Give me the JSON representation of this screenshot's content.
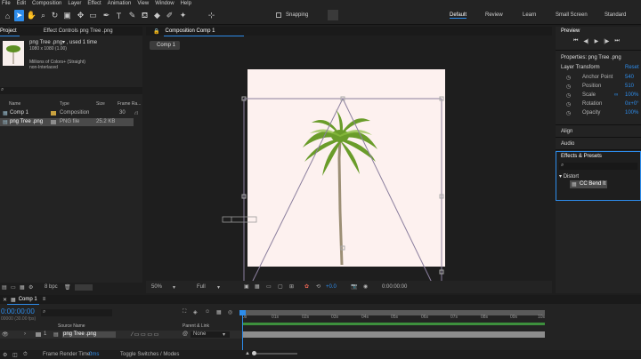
{
  "menu": [
    "File",
    "Edit",
    "Composition",
    "Layer",
    "Effect",
    "Animation",
    "View",
    "Window",
    "Help"
  ],
  "toolbar": {
    "snapping_label": "Snapping",
    "workspaces": [
      "Default",
      "Review",
      "Learn",
      "Small Screen",
      "Standard"
    ],
    "active_workspace": "Default"
  },
  "project": {
    "tab_label": "Project",
    "effect_controls_label": "Effect Controls png Tree .png",
    "item_name": "png Tree .png▾ , used 1 time",
    "item_dims": "1080 x 1080 (1.00)",
    "item_colors": "Millions of Colors+ (Straight)",
    "item_interlace": "non-Interlaced",
    "columns": {
      "name": "Name",
      "type": "Type",
      "size": "Size",
      "frame_rate": "Frame Ra..."
    },
    "items": [
      {
        "name": "Comp 1",
        "type": "Composition",
        "size": "",
        "fps": "30"
      },
      {
        "name": "png Tree .png",
        "type": "PNG file",
        "size": "25.2 KB",
        "fps": ""
      }
    ],
    "bpc": "8 bpc"
  },
  "composition": {
    "tab_label": "Composition Comp 1",
    "comp_tab": "Comp 1",
    "zoom": "50%",
    "resolution": "Full",
    "exposure": "+0.0",
    "timecode": "0:00:00:00"
  },
  "preview": {
    "title": "Preview"
  },
  "properties": {
    "title": "Properties: png Tree .png",
    "section": "Layer Transform",
    "reset": "Reset",
    "rows": [
      {
        "label": "Anchor Point",
        "value": "540"
      },
      {
        "label": "Position",
        "value": "510"
      },
      {
        "label": "Scale",
        "value": "100%"
      },
      {
        "label": "Rotation",
        "value": "0x+0°"
      },
      {
        "label": "Opacity",
        "value": "100%"
      }
    ]
  },
  "align": {
    "title": "Align"
  },
  "audio": {
    "title": "Audio"
  },
  "effects": {
    "title": "Effects & Presets",
    "category": "Distort",
    "item": "CC Bend It"
  },
  "timeline": {
    "tab": "Comp 1",
    "timecode": "0:00:00:00",
    "fps_sub": "00000 (30.00 fps)",
    "col_source": "Source Name",
    "col_parent": "Parent & Link",
    "layer_num": "1",
    "layer_name": "png Tree .png",
    "parent_value": "None",
    "ticks": [
      "0s",
      "01s",
      "02s",
      "03s",
      "04s",
      "05s",
      "06s",
      "07s",
      "08s",
      "09s",
      "10s"
    ],
    "render_time_label": "Frame Render Time:",
    "render_time_value": "0ms",
    "toggle_label": "Toggle Switches / Modes"
  },
  "colors": {
    "accent": "#2d8ceb",
    "canvas": "#fdf1ef",
    "palm_leaf": "#6a9c2a",
    "trunk": "#a89a80"
  }
}
